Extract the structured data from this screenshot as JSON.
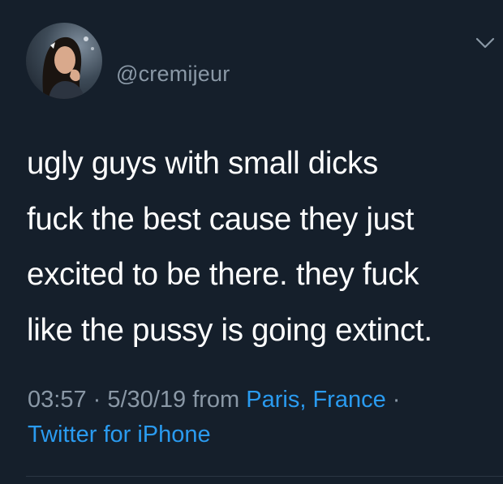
{
  "tweet": {
    "handle": "@cremijeur",
    "body_lines": [
      "ugly guys with small dicks",
      "fuck the best cause they just",
      "excited to be there. they fuck",
      "like the pussy is going extinct."
    ],
    "time": "03:57",
    "separator": "·",
    "date": "5/30/19",
    "from_text": "from",
    "location": "Paris, France",
    "client": "Twitter for iPhone"
  },
  "icons": {
    "menu": "chevron-down-icon",
    "avatar": "avatar"
  },
  "colors": {
    "background": "#151f2b",
    "text": "#ffffff",
    "secondary": "#8a98a6",
    "link": "#2a9bf0"
  }
}
